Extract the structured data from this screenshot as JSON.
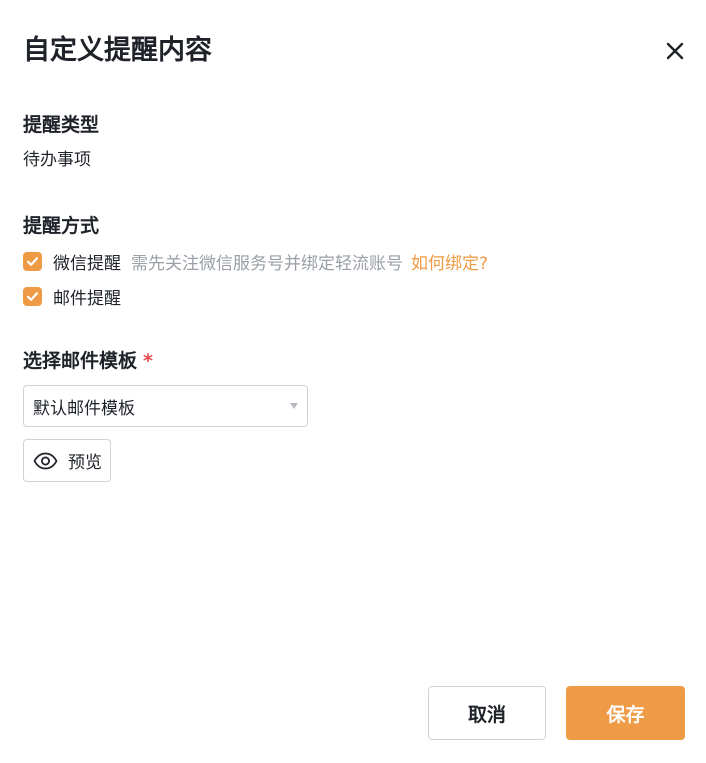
{
  "dialog": {
    "title": "自定义提醒内容",
    "close_icon": "close-icon"
  },
  "reminder_type": {
    "label": "提醒类型",
    "value": "待办事项"
  },
  "reminder_method": {
    "label": "提醒方式",
    "options": [
      {
        "label": "微信提醒",
        "checked": true,
        "hint": "需先关注微信服务号并绑定轻流账号",
        "link": "如何绑定?"
      },
      {
        "label": "邮件提醒",
        "checked": true
      }
    ]
  },
  "email_template": {
    "label": "选择邮件模板",
    "required_mark": "*",
    "selected": "默认邮件模板",
    "preview_label": "预览",
    "preview_icon": "eye-icon"
  },
  "footer": {
    "cancel_label": "取消",
    "save_label": "保存"
  },
  "colors": {
    "accent": "#ef9a45",
    "required": "#e5484d",
    "hint": "#9aa0a6"
  }
}
